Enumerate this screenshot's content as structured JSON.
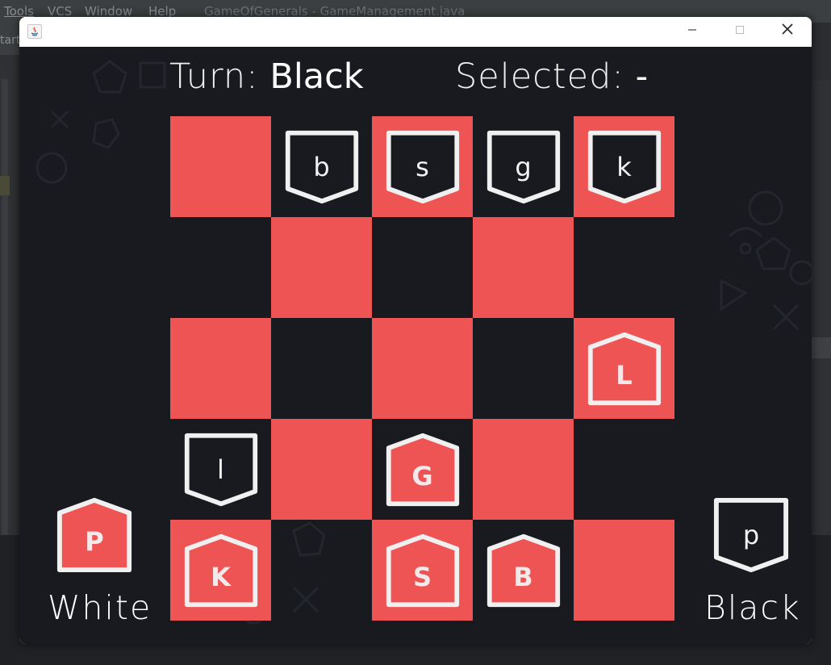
{
  "ide": {
    "menu": [
      "Tools",
      "VCS",
      "Window",
      "Help"
    ],
    "title": "GameOfGenerals - GameManagement.java",
    "toolbar_text": "tart"
  },
  "window": {
    "controls": {
      "minimize": "—",
      "maximize": "☐",
      "close": "✕"
    }
  },
  "hud": {
    "turn_label": "Turn:",
    "turn_value": "Black",
    "selected_label": "Selected:",
    "selected_value": "-"
  },
  "colors": {
    "red": "#ef5455",
    "background": "#181a1f",
    "piece_outline": "#f0f0f0"
  },
  "board": {
    "rows": 5,
    "cols": 5,
    "red_squares": [
      [
        0,
        0
      ],
      [
        0,
        2
      ],
      [
        0,
        4
      ],
      [
        1,
        1
      ],
      [
        1,
        3
      ],
      [
        2,
        0
      ],
      [
        2,
        2
      ],
      [
        2,
        4
      ],
      [
        3,
        1
      ],
      [
        3,
        3
      ],
      [
        4,
        0
      ],
      [
        4,
        2
      ],
      [
        4,
        4
      ]
    ],
    "pieces": [
      {
        "row": 0,
        "col": 1,
        "letter": "b",
        "side": "black"
      },
      {
        "row": 0,
        "col": 2,
        "letter": "s",
        "side": "black"
      },
      {
        "row": 0,
        "col": 3,
        "letter": "g",
        "side": "black"
      },
      {
        "row": 0,
        "col": 4,
        "letter": "k",
        "side": "black"
      },
      {
        "row": 2,
        "col": 4,
        "letter": "L",
        "side": "white"
      },
      {
        "row": 3,
        "col": 0,
        "letter": "l",
        "side": "black"
      },
      {
        "row": 3,
        "col": 2,
        "letter": "G",
        "side": "white"
      },
      {
        "row": 4,
        "col": 0,
        "letter": "K",
        "side": "white"
      },
      {
        "row": 4,
        "col": 2,
        "letter": "S",
        "side": "white"
      },
      {
        "row": 4,
        "col": 3,
        "letter": "B",
        "side": "white"
      }
    ]
  },
  "reserves": {
    "white": {
      "label": "White",
      "piece": "P",
      "side": "white"
    },
    "black": {
      "label": "Black",
      "piece": "p",
      "side": "black"
    }
  }
}
